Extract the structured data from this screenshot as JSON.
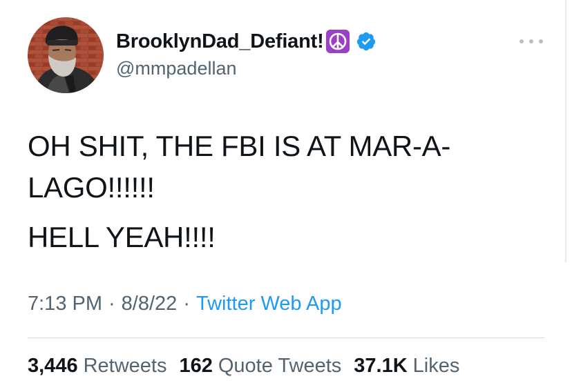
{
  "user": {
    "display_name": "BrooklynDad_Defiant!",
    "handle": "@mmpadellan",
    "badge_icons": [
      "peace-symbol-icon",
      "verified-badge-icon"
    ],
    "verified_color": "#1d9bf0",
    "peace_badge_color": "#9b3fc6"
  },
  "tweet": {
    "lines": [
      "OH SHIT, THE FBI IS AT MAR-A-LAGO!!!!!!",
      "HELL YEAH!!!!"
    ],
    "time": "7:13 PM",
    "separator": "·",
    "date": "8/8/22",
    "source": "Twitter Web App"
  },
  "stats": [
    {
      "count": "3,446",
      "label": "Retweets"
    },
    {
      "count": "162",
      "label": "Quote Tweets"
    },
    {
      "count": "37.1K",
      "label": "Likes"
    }
  ],
  "colors": {
    "text": "#0f1419",
    "secondary": "#536471",
    "link": "#1d9bf0",
    "divider": "#cfd9de"
  }
}
